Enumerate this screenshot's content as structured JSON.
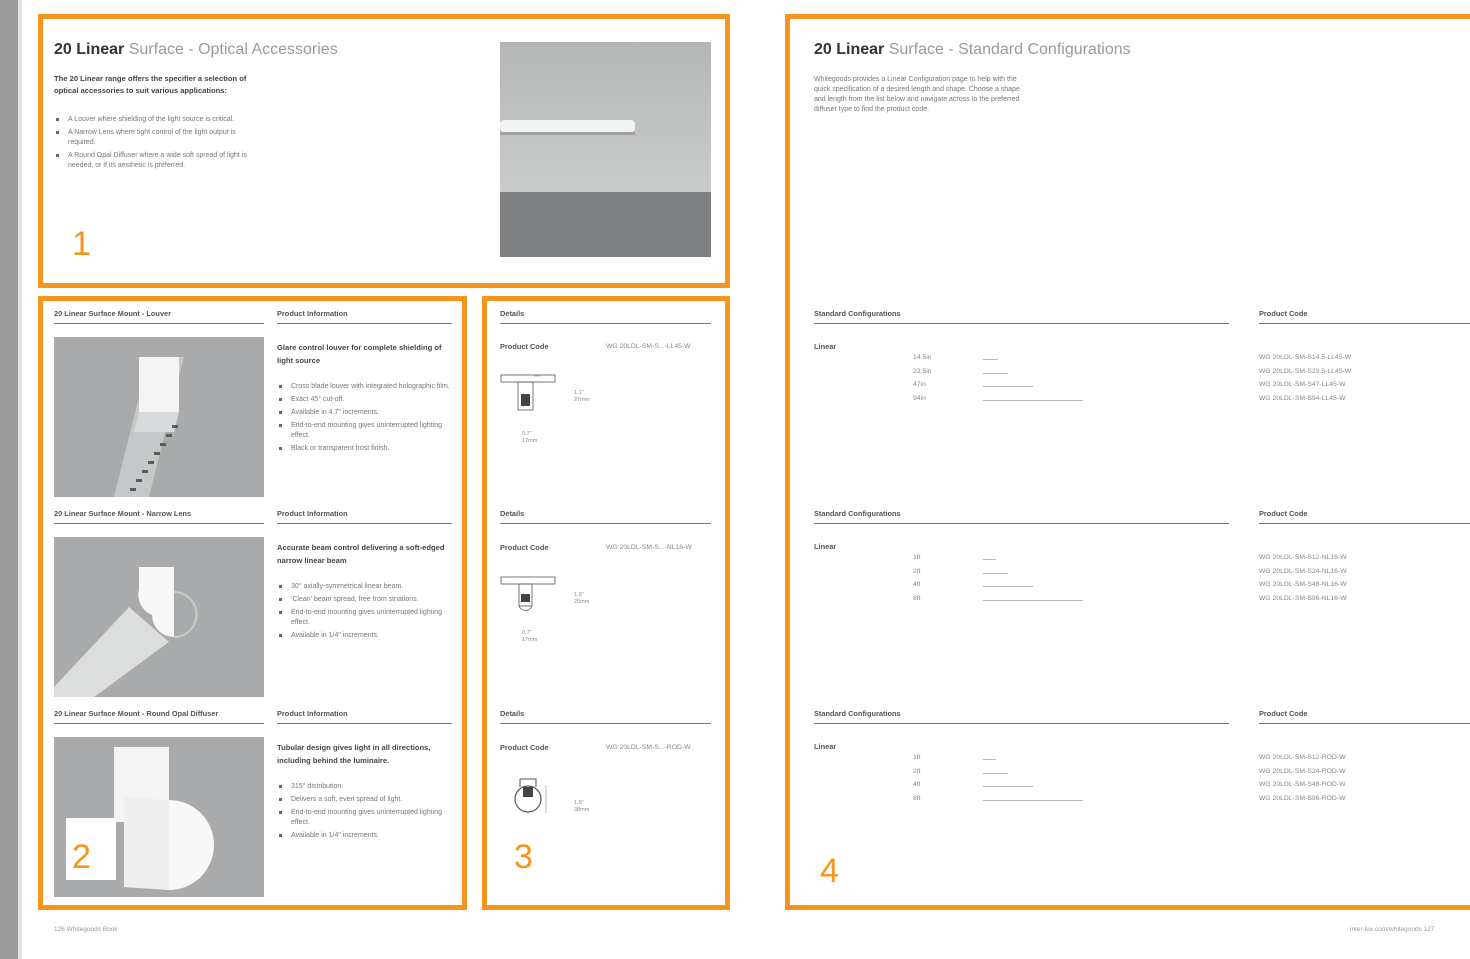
{
  "left_page": {
    "title": {
      "bold": "20 Linear",
      "rest": "Surface - Optical Accessories"
    },
    "intro": "The 20 Linear range offers the specifier a selection of optical accessories to suit various applications:",
    "intro_bullets": [
      "A Louver where shielding of the light source is critical.",
      "A Narrow Lens where tight control of the light output is required.",
      "A Round Opal Diffuser where a wide soft spread of light is needed, or if its aesthetic is preferred."
    ],
    "products": [
      {
        "heading": "20 Linear Surface Mount - Louver",
        "info_heading": "Product Information",
        "info_title": "Glare control louver for complete shielding of light source",
        "bullets": [
          "Cross blade louver with integrated holographic film.",
          "Exact 45° cut-off.",
          "Available in 4.7\" increments.",
          "End-to-end mounting gives uninterrupted lighting effect.",
          "Black or transparent frost finish."
        ],
        "details_heading": "Details",
        "code_label": "Product Code",
        "code": "WG 20LDL-SM-S...-LL45-W",
        "dim_height": "1.1\"\n27mm",
        "dim_width": "0.7\"\n17mm"
      },
      {
        "heading": "20 Linear Surface Mount - Narrow Lens",
        "info_heading": "Product Information",
        "info_title": "Accurate beam control delivering a soft-edged narrow linear beam",
        "bullets": [
          "30° axially-symmetrical linear beam.",
          "'Clean' beam spread, free from striations.",
          "End-to-end mounting gives uninterrupted lighting effect.",
          "Available in 1/4\" increments."
        ],
        "details_heading": "Details",
        "code_label": "Product Code",
        "code": "WG 20LDL-SM-S...-NL16-W",
        "dim_height": "1.0\"\n25mm",
        "dim_width": "0.7\"\n17mm"
      },
      {
        "heading": "20 Linear Surface Mount - Round Opal Diffuser",
        "info_heading": "Product Information",
        "info_title": "Tubular design gives light in all directions, including behind the luminaire.",
        "bullets": [
          "315° distribution.",
          "Delivers a soft, even spread of light.",
          "End-to-end mounting gives uninterrupted lighting effect.",
          "Available in 1/4\" increments."
        ],
        "details_heading": "Details",
        "code_label": "Product Code",
        "code": "WG 20LDL-SM-S...-ROD-W",
        "dim_height": "1.5\"\n38mm",
        "dim_width": ""
      }
    ],
    "footer": "126   Whitegoods Book"
  },
  "right_page": {
    "title": {
      "bold": "20 Linear",
      "rest": "Surface - Standard Configurations"
    },
    "intro": "Whitegoods provides a Linear Configuration page to help with the quick specification of a desired length and shape. Choose a shape and length from the list below and navigate across to the preferred diffuser type to find the product code.",
    "sections": [
      {
        "heading": "Standard Configurations",
        "code_heading": "Product Code",
        "shape": "Linear",
        "rows": [
          {
            "length": "14.5in",
            "bar": 0.15,
            "code": "WG 20LDL-SM-S14.5-LL45-W"
          },
          {
            "length": "23.5in",
            "bar": 0.25,
            "code": "WG 20LDL-SM-S23.5-LL45-W"
          },
          {
            "length": "47in",
            "bar": 0.5,
            "code": "WG 20LDL-SM-S47-LL45-W"
          },
          {
            "length": "94in",
            "bar": 1.0,
            "code": "WG 20LDL-SM-S94-LL45-W"
          }
        ]
      },
      {
        "heading": "Standard Configurations",
        "code_heading": "Product Code",
        "shape": "Linear",
        "rows": [
          {
            "length": "1ft",
            "bar": 0.125,
            "code": "WG 20LDL-SM-S12-NL16-W"
          },
          {
            "length": "2ft",
            "bar": 0.25,
            "code": "WG 20LDL-SM-S24-NL16-W"
          },
          {
            "length": "4ft",
            "bar": 0.5,
            "code": "WG 20LDL-SM-S48-NL16-W"
          },
          {
            "length": "8ft",
            "bar": 1.0,
            "code": "WG 20LDL-SM-S96-NL16-W"
          }
        ]
      },
      {
        "heading": "Standard Configurations",
        "code_heading": "Product Code",
        "shape": "Linear",
        "rows": [
          {
            "length": "1ft",
            "bar": 0.125,
            "code": "WG 20LDL-SM-S12-ROD-W"
          },
          {
            "length": "2ft",
            "bar": 0.25,
            "code": "WG 20LDL-SM-S24-ROD-W"
          },
          {
            "length": "4ft",
            "bar": 0.5,
            "code": "WG 20LDL-SM-S48-ROD-W"
          },
          {
            "length": "8ft",
            "bar": 1.0,
            "code": "WG 20LDL-SM-S96-ROD-W"
          }
        ]
      }
    ],
    "footer": "inter-lux.com/whitegoods   127"
  },
  "annotations": {
    "box1": "1",
    "box2": "2",
    "box3": "3",
    "box4": "4",
    "color": "#f7941d"
  }
}
